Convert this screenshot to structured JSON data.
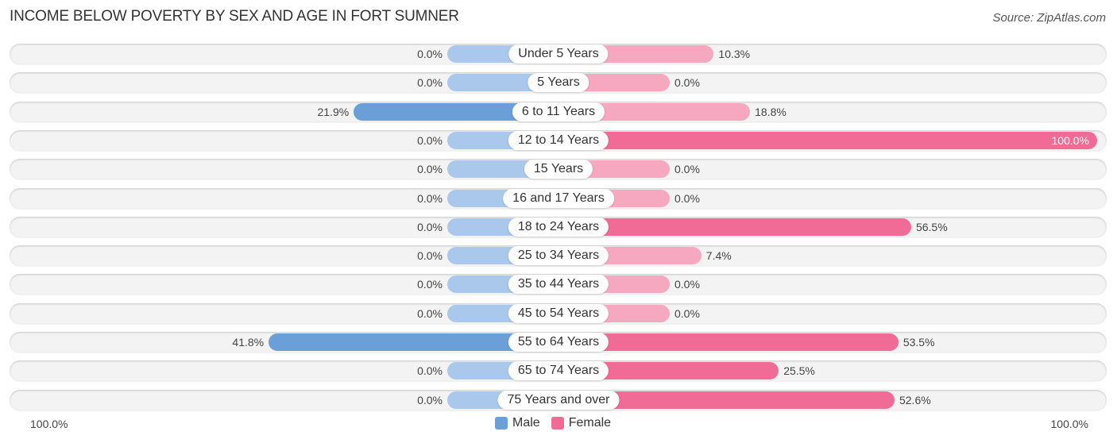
{
  "header": {
    "title": "INCOME BELOW POVERTY BY SEX AND AGE IN FORT SUMNER",
    "source": "Source: ZipAtlas.com"
  },
  "colors": {
    "male": "#6a9fd8",
    "male_light": "#a9c8ec",
    "female": "#f06b95",
    "female_light": "#f5a8c0"
  },
  "chart_data": {
    "type": "bar",
    "orientation": "horizontal-diverging",
    "title": "INCOME BELOW POVERTY BY SEX AND AGE IN FORT SUMNER",
    "categories": [
      "Under 5 Years",
      "5 Years",
      "6 to 11 Years",
      "12 to 14 Years",
      "15 Years",
      "16 and 17 Years",
      "18 to 24 Years",
      "25 to 34 Years",
      "35 to 44 Years",
      "45 to 54 Years",
      "55 to 64 Years",
      "65 to 74 Years",
      "75 Years and over"
    ],
    "series": [
      {
        "name": "Male",
        "values": [
          0.0,
          0.0,
          21.9,
          0.0,
          0.0,
          0.0,
          0.0,
          0.0,
          0.0,
          0.0,
          41.8,
          0.0,
          0.0
        ],
        "labels": [
          "0.0%",
          "0.0%",
          "21.9%",
          "0.0%",
          "0.0%",
          "0.0%",
          "0.0%",
          "0.0%",
          "0.0%",
          "0.0%",
          "41.8%",
          "0.0%",
          "0.0%"
        ]
      },
      {
        "name": "Female",
        "values": [
          10.3,
          0.0,
          18.8,
          100.0,
          0.0,
          0.0,
          56.5,
          7.4,
          0.0,
          0.0,
          53.5,
          25.5,
          52.6
        ],
        "labels": [
          "10.3%",
          "0.0%",
          "18.8%",
          "100.0%",
          "0.0%",
          "0.0%",
          "56.5%",
          "7.4%",
          "0.0%",
          "0.0%",
          "53.5%",
          "25.5%",
          "52.6%"
        ]
      }
    ],
    "xlim": [
      -100,
      100
    ],
    "axis_labels": {
      "left": "100.0%",
      "right": "100.0%"
    },
    "legend": {
      "position": "bottom-center",
      "entries": [
        "Male",
        "Female"
      ]
    }
  }
}
